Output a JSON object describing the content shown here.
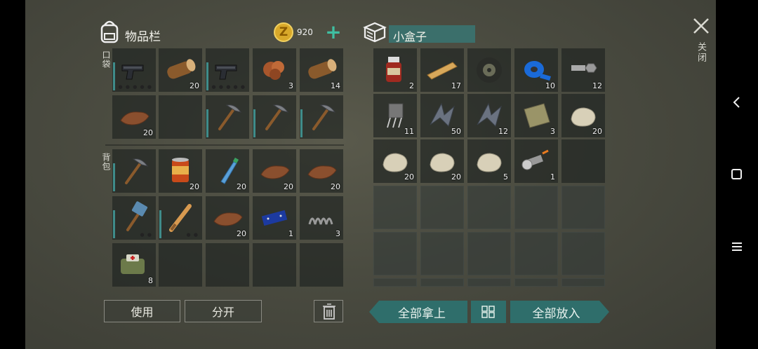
{
  "inventory": {
    "title": "物品栏",
    "coins": "920",
    "pocket_label": "口袋",
    "backpack_label": "背包",
    "pocket_slots": [
      {
        "item": "pistol-icon",
        "count": ""
      },
      {
        "item": "log-icon",
        "count": "20"
      },
      {
        "item": "pistol-icon",
        "count": ""
      },
      {
        "item": "ore-icon",
        "count": "3"
      },
      {
        "item": "log-icon",
        "count": "14"
      },
      {
        "item": "leather-icon",
        "count": "20"
      },
      {
        "item": "",
        "count": ""
      },
      {
        "item": "pickaxe-icon",
        "count": ""
      },
      {
        "item": "pickaxe-icon",
        "count": ""
      },
      {
        "item": "pickaxe-icon",
        "count": ""
      }
    ],
    "backpack_slots": [
      {
        "item": "pickaxe-icon",
        "count": ""
      },
      {
        "item": "food-can-icon",
        "count": "20"
      },
      {
        "item": "water-bottle-icon",
        "count": "20"
      },
      {
        "item": "leather-icon",
        "count": "20"
      },
      {
        "item": "leather-icon",
        "count": "20"
      },
      {
        "item": "sledgehammer-icon",
        "count": ""
      },
      {
        "item": "baseball-bat-icon",
        "count": ""
      },
      {
        "item": "leather-icon",
        "count": "20"
      },
      {
        "item": "circuit-board-icon",
        "count": "1"
      },
      {
        "item": "spring-icon",
        "count": "3"
      },
      {
        "item": "first-aid-bag-icon",
        "count": "8"
      },
      {
        "item": "",
        "count": ""
      },
      {
        "item": "",
        "count": ""
      },
      {
        "item": "",
        "count": ""
      },
      {
        "item": "",
        "count": ""
      }
    ],
    "use_button": "使用",
    "split_button": "分开"
  },
  "container": {
    "title": "小盒子",
    "slots": [
      {
        "item": "medicine-bottle-icon",
        "count": "2"
      },
      {
        "item": "wood-plank-icon",
        "count": "17"
      },
      {
        "item": "tire-icon",
        "count": ""
      },
      {
        "item": "blue-tape-icon",
        "count": "10"
      },
      {
        "item": "bolt-nut-icon",
        "count": "12"
      },
      {
        "item": "electronic-component-icon",
        "count": "11"
      },
      {
        "item": "metal-scrap-icon",
        "count": "50"
      },
      {
        "item": "metal-scrap-icon",
        "count": "12"
      },
      {
        "item": "cloth-icon",
        "count": "3"
      },
      {
        "item": "stone-icon",
        "count": "20"
      },
      {
        "item": "stone-icon",
        "count": "20"
      },
      {
        "item": "stone-icon",
        "count": "20"
      },
      {
        "item": "stone-icon",
        "count": "5"
      },
      {
        "item": "flashlight-icon",
        "count": "1"
      },
      {
        "item": "",
        "count": ""
      }
    ],
    "take_all_button": "全部拿上",
    "put_all_button": "全部放入"
  },
  "close_label": "关闭",
  "colors": {
    "teal": "#2f6e6b",
    "accent_plus": "#3fbfa2",
    "coin": "#d9a92a"
  }
}
